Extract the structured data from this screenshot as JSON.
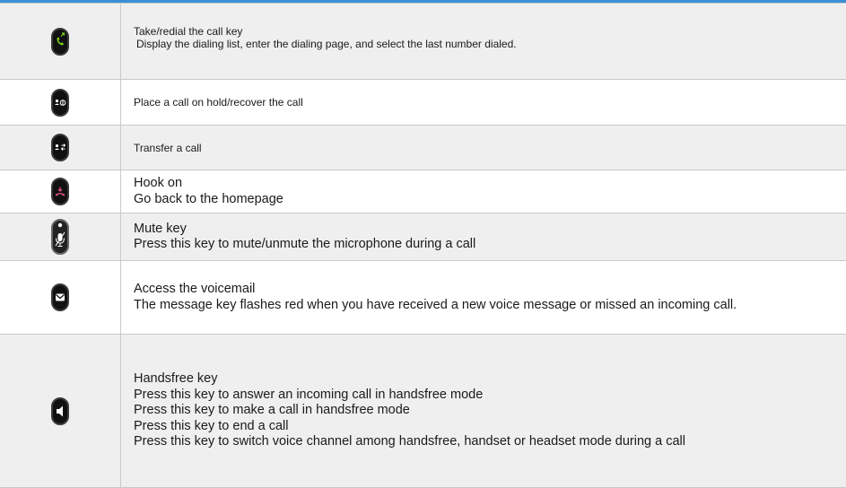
{
  "rows": [
    {
      "icon": "call-redial-key-icon",
      "title": "Take/redial the call key",
      "lines": [
        "Display the dialing list, enter the dialing page, and select the last number dialed."
      ]
    },
    {
      "icon": "hold-key-icon",
      "title": "Place a call on hold/recover the call",
      "lines": []
    },
    {
      "icon": "transfer-key-icon",
      "title": "Transfer a call",
      "lines": []
    },
    {
      "icon": "hook-on-key-icon",
      "title": "Hook on",
      "lines": [
        "Go back to the homepage"
      ]
    },
    {
      "icon": "mute-key-icon",
      "title": "Mute key",
      "lines": [
        "Press this key to mute/unmute the microphone during a call"
      ]
    },
    {
      "icon": "voicemail-key-icon",
      "title": "Access the voicemail",
      "lines": [
        "The message key flashes red when you have received a new voice message or missed an incoming call."
      ]
    },
    {
      "icon": "handsfree-key-icon",
      "title": "Handsfree key",
      "lines": [
        "Press this key to answer an incoming call in handsfree mode",
        "Press this key to make a call in handsfree mode",
        "Press this key to end a call",
        "Press this key to switch voice channel among handsfree, handset or headset mode during a call"
      ]
    }
  ],
  "colors": {
    "accent": "#3a8fd8",
    "green": "#7ed321",
    "red": "#e0507a",
    "key": "#111111"
  }
}
